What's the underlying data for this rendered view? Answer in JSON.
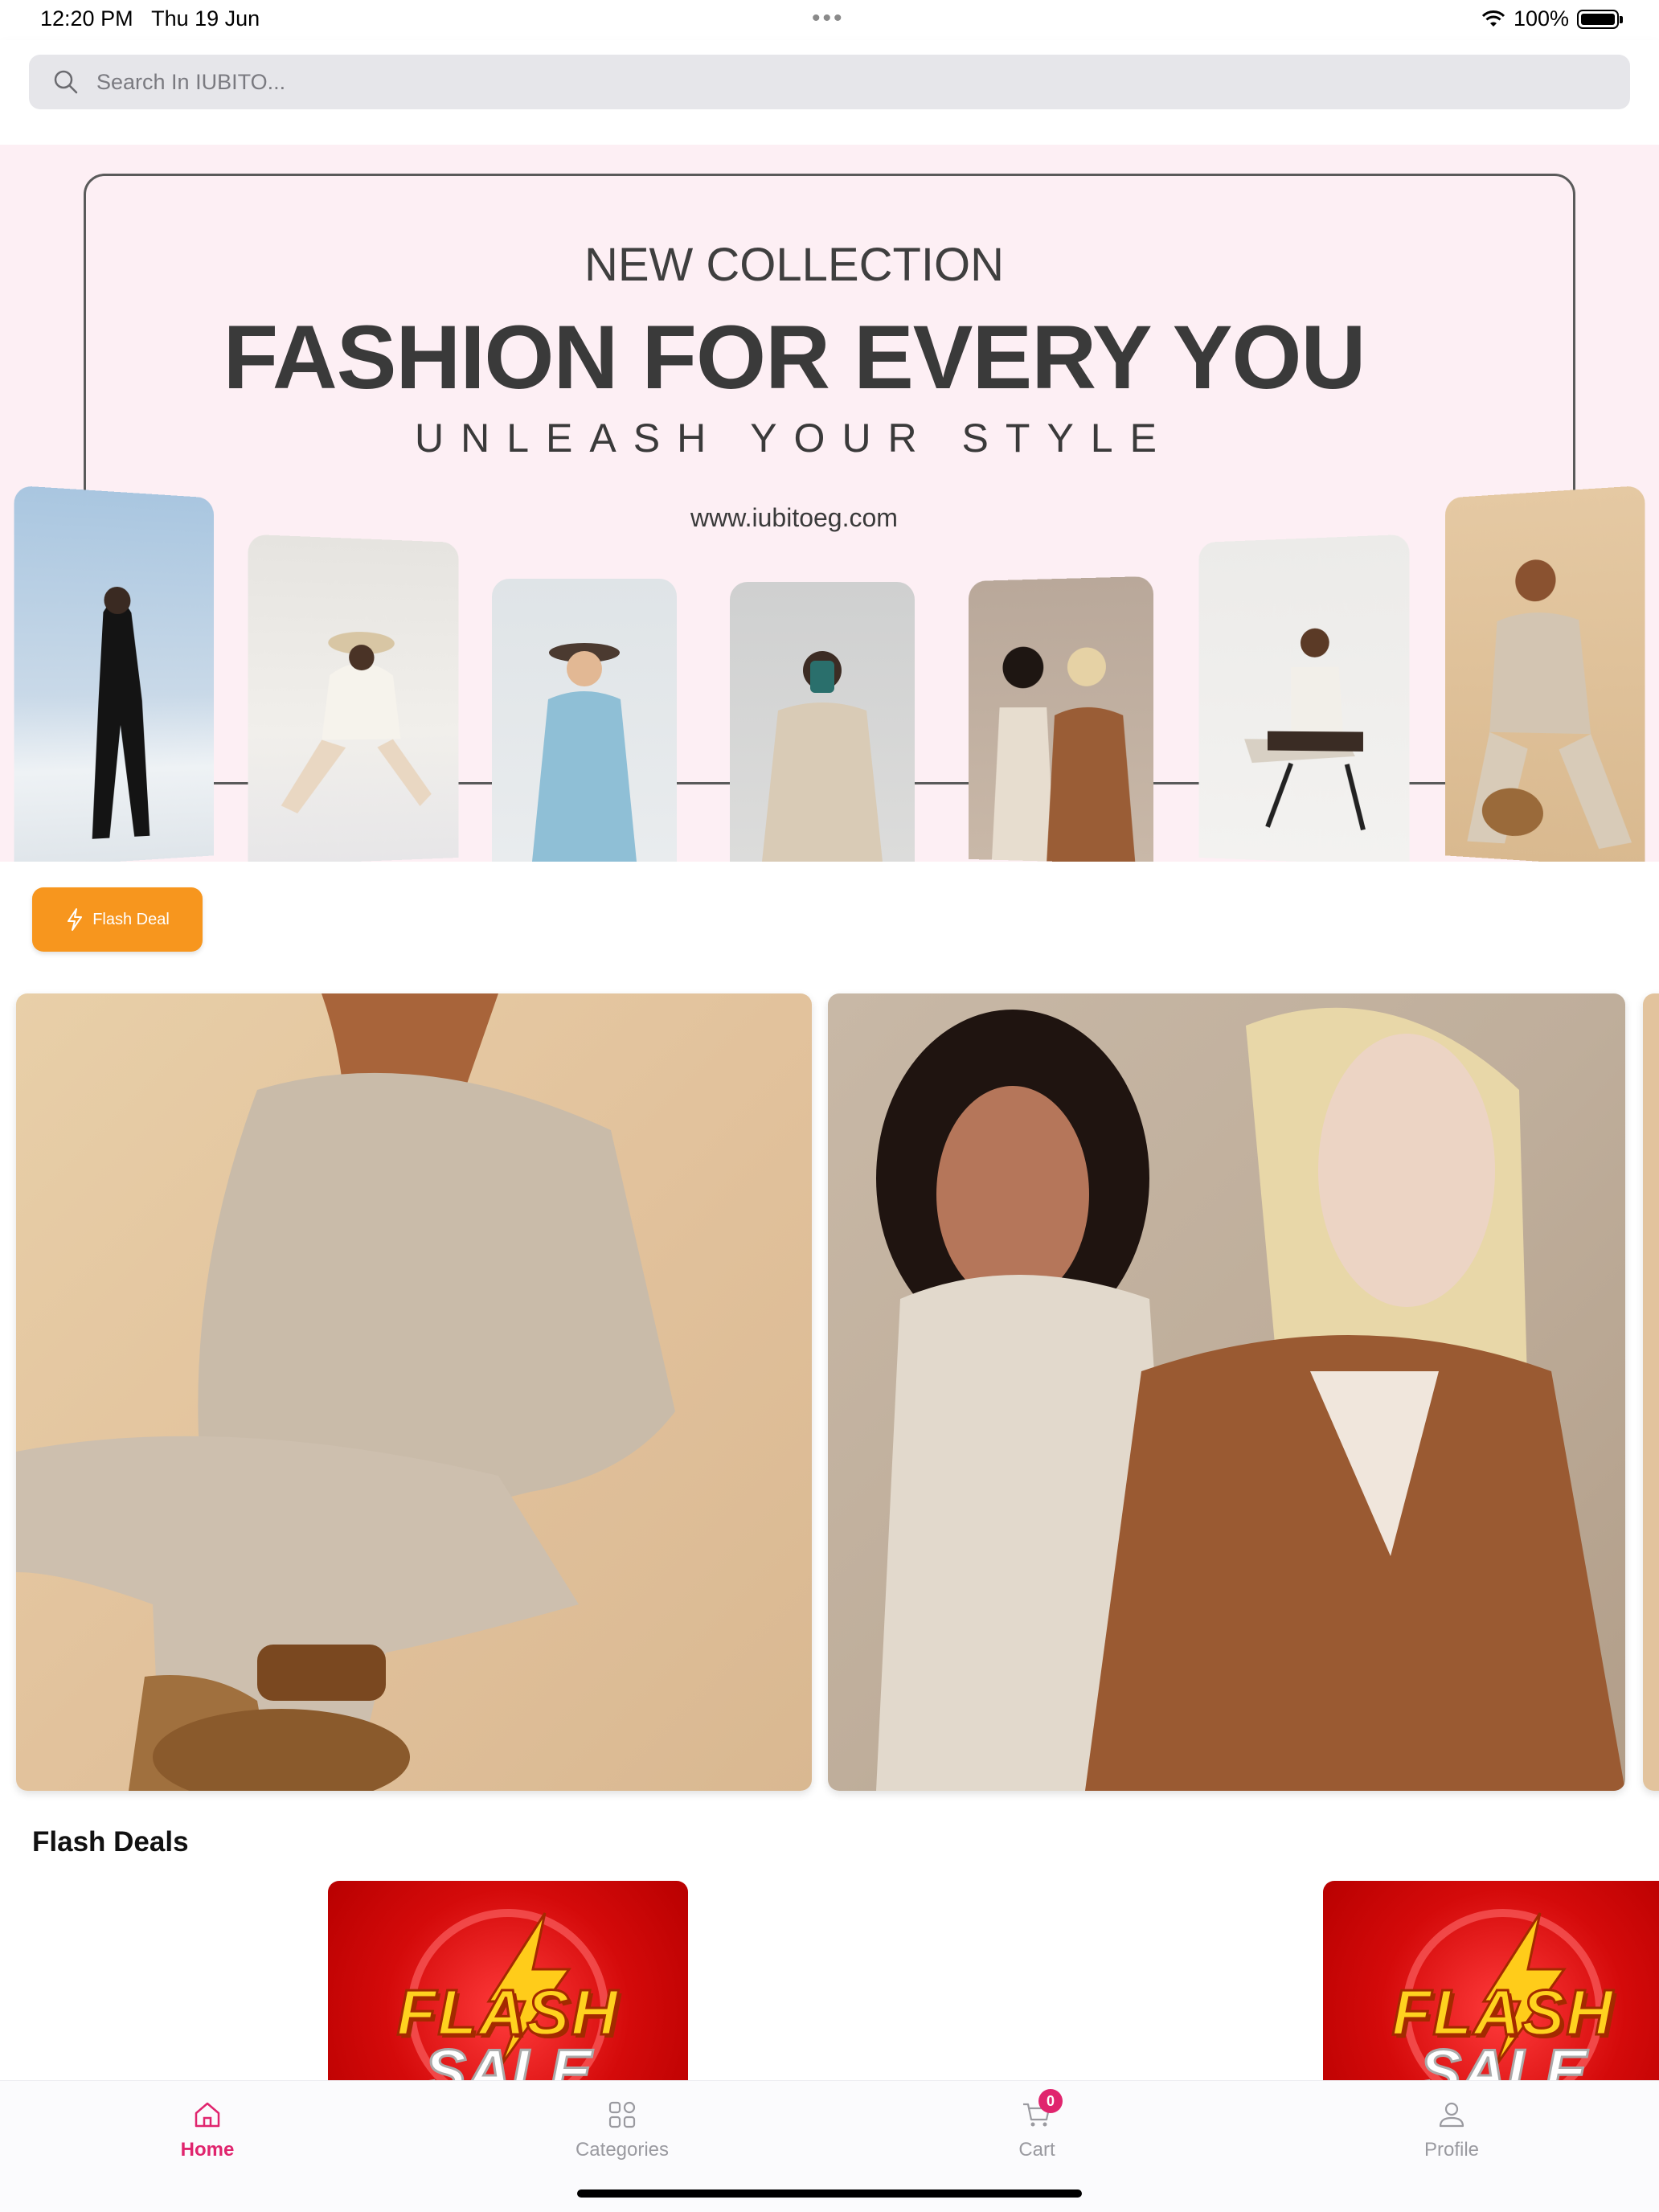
{
  "status_bar": {
    "time": "12:20 PM",
    "date": "Thu 19 Jun",
    "battery": "100%"
  },
  "search": {
    "placeholder": "Search In IUBITO..."
  },
  "banner": {
    "kicker": "NEW COLLECTION",
    "title": "FASHION FOR EVERY YOU",
    "tagline": "UNLEASH YOUR STYLE",
    "url": "www.iubitoeg.com"
  },
  "flash_deal_button": {
    "label": "Flash Deal"
  },
  "flash_deals": {
    "title": "Flash Deals",
    "cards": [
      {
        "word1": "FLASH",
        "word2": "SALE"
      },
      {
        "word1": "FLASH",
        "word2": "SALE"
      }
    ]
  },
  "tabs": [
    {
      "label": "Home",
      "icon": "home-icon",
      "active": true
    },
    {
      "label": "Categories",
      "icon": "grid-icon",
      "active": false
    },
    {
      "label": "Cart",
      "icon": "cart-icon",
      "active": false,
      "badge": "0"
    },
    {
      "label": "Profile",
      "icon": "user-icon",
      "active": false
    }
  ],
  "colors": {
    "accent": "#e0256e",
    "flash_button": "#f7961e",
    "banner_bg": "#fdeff4"
  }
}
